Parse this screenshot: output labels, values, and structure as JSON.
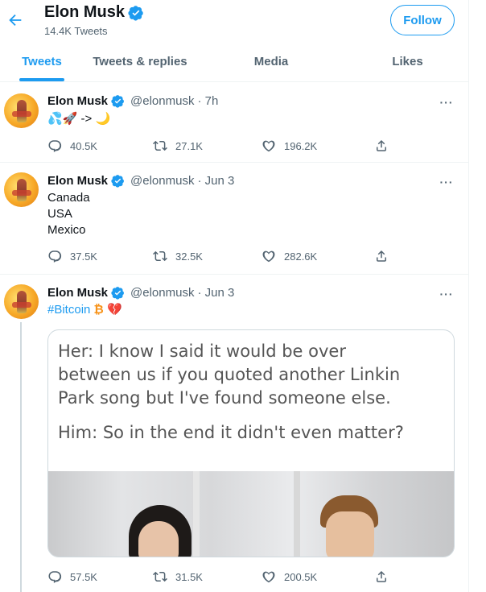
{
  "header": {
    "name": "Elon Musk",
    "tweet_count": "14.4K Tweets",
    "follow_label": "Follow"
  },
  "tabs": [
    "Tweets",
    "Tweets & replies",
    "Media",
    "Likes"
  ],
  "active_tab": "Tweets",
  "colors": {
    "accent": "#1d9bf0",
    "text": "#0f1419",
    "muted": "#536471"
  },
  "tweets": [
    {
      "name": "Elon Musk",
      "handle": "@elonmusk",
      "time": "· 7h",
      "body": [
        "💦🚀 -> 🌙"
      ],
      "replies": "40.5K",
      "retweets": "27.1K",
      "likes": "196.2K"
    },
    {
      "name": "Elon Musk",
      "handle": "@elonmusk",
      "time": "· Jun 3",
      "body": [
        "Canada",
        "USA",
        "Mexico"
      ],
      "replies": "37.5K",
      "retweets": "32.5K",
      "likes": "282.6K"
    },
    {
      "name": "Elon Musk",
      "handle": "@elonmusk",
      "time": "· Jun 3",
      "hashtag": "#Bitcoin",
      "emoji": "₿ 💔",
      "media_text": [
        "Her: I know I said it would be over",
        "between us if you quoted another Linkin",
        "Park song but I've found someone else.",
        "Him: So in the end it didn't even matter?"
      ],
      "replies": "57.5K",
      "retweets": "31.5K",
      "likes": "200.5K"
    }
  ]
}
